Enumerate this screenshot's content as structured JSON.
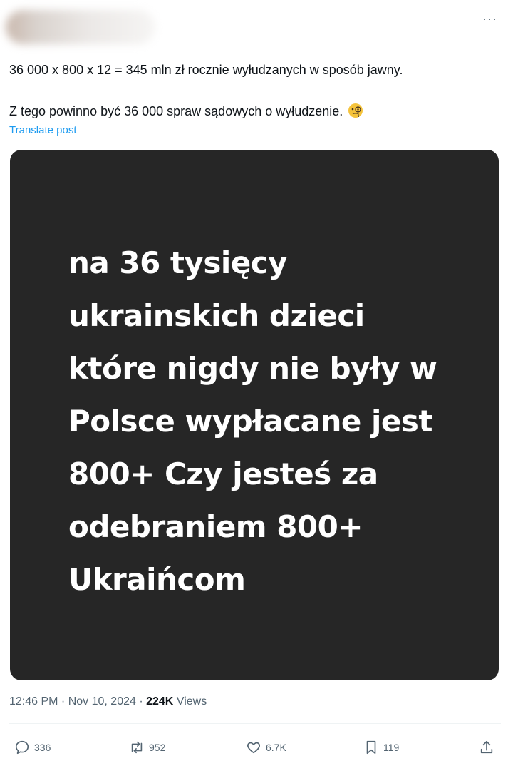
{
  "header": {
    "more_label": "···"
  },
  "post": {
    "line1": "36 000 x 800 x 12 = 345 mln zł rocznie wyłudzanych w sposób jawny.",
    "line2": "Z tego powinno być 36 000 spraw sądowych o wyłudzenie.",
    "emoji": "face-with-monocle-icon",
    "translate_label": "Translate post"
  },
  "media": {
    "lines": [
      "na 36 tysięcy",
      "ukrainskich dzieci",
      "które nigdy nie były w",
      "Polsce wypłacane jest",
      "800+ Czy jesteś za",
      "odebraniem 800+",
      "Ukraińcom"
    ]
  },
  "meta": {
    "time": "12:46 PM",
    "sep1": " · ",
    "date": "Nov 10, 2024",
    "sep2": " · ",
    "views_count": "224K",
    "views_label": " Views"
  },
  "actions": {
    "replies": "336",
    "reposts": "952",
    "likes": "6.7K",
    "bookmarks": "119"
  },
  "colors": {
    "accent": "#1d9bf0",
    "muted": "#536471",
    "media_bg": "#262626"
  }
}
